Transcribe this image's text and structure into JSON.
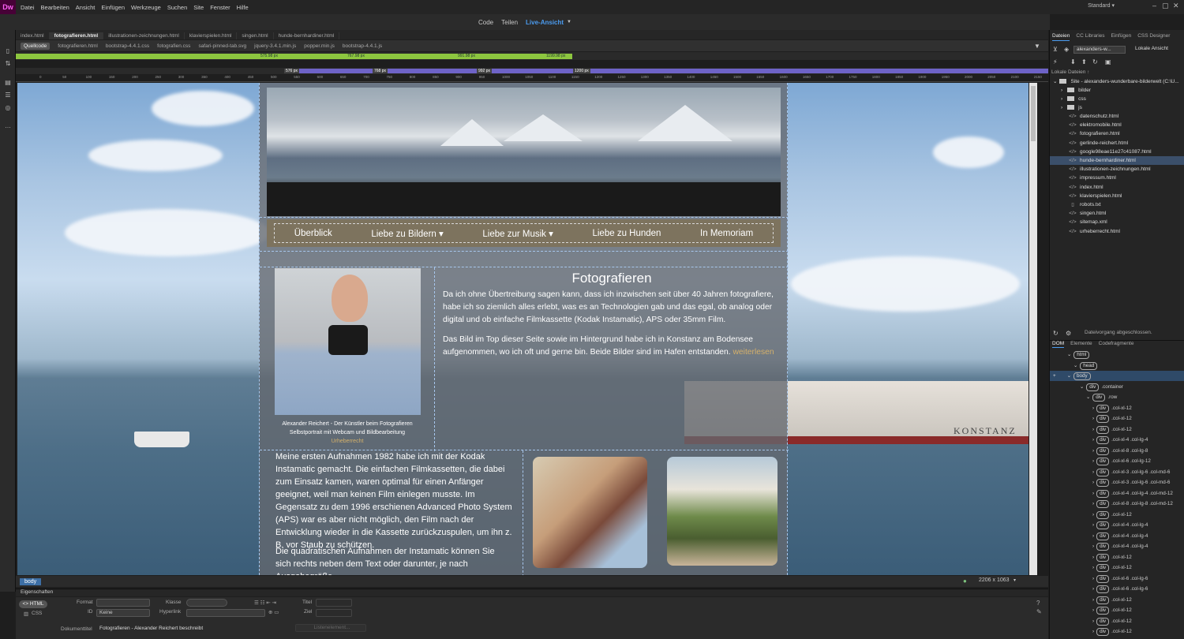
{
  "app": {
    "logo": "Dw",
    "menu": [
      "Datei",
      "Bearbeiten",
      "Ansicht",
      "Einfügen",
      "Werkzeuge",
      "Suchen",
      "Site",
      "Fenster",
      "Hilfe"
    ],
    "workspace": "Standard",
    "view_modes": [
      "Code",
      "Teilen",
      "Live-Ansicht"
    ]
  },
  "doc_tabs": [
    "index.html",
    "fotografieren.html",
    "illustrationen-zeichnungen.html",
    "klavierspielen.html",
    "singen.html",
    "hunde-bernhardiner.html"
  ],
  "active_tab": "fotografieren.html",
  "related_files": [
    "Quellcode",
    "fotografieren.html",
    "bootstrap-4.4.1.css",
    "fotografien.css",
    "safari-pinned-tab.svg",
    "jquery-3.4.1.min.js",
    "popper.min.js",
    "bootstrap-4.4.1.js"
  ],
  "media_queries": {
    "bar1": [
      "575.98 px",
      "767.98 px",
      "991.98 px",
      "1199.98 px"
    ],
    "bar2": [
      "576 px",
      "768 px",
      "992 px",
      "1200 px"
    ]
  },
  "ruler": [
    "0",
    "50",
    "100",
    "150",
    "200",
    "250",
    "300",
    "350",
    "400",
    "450",
    "500",
    "550",
    "600",
    "650",
    "700",
    "750",
    "800",
    "850",
    "900",
    "950",
    "1000",
    "1050",
    "1100",
    "1150",
    "1200",
    "1250",
    "1300",
    "1350",
    "1400",
    "1450",
    "1500",
    "1550",
    "1600",
    "1650",
    "1700",
    "1750",
    "1800",
    "1850",
    "1900",
    "1950",
    "2000",
    "2050",
    "2100",
    "2150"
  ],
  "page": {
    "nav": [
      "Überblick",
      "Liebe zu Bildern ▾",
      "Liebe zur Musik ▾",
      "Liebe zu Hunden",
      "In Memoriam"
    ],
    "caption_line1": "Alexander Reichert - Der Künstler beim Fotografieren",
    "caption_line2": "Selbstportrait mit Webcam und Bildbearbeitung",
    "caption_link": "Urheberrecht",
    "heading": "Fotografieren",
    "p1": "Da ich ohne Übertreibung sagen kann, dass ich inzwischen seit über 40 Jahren fotografiere, habe ich so ziemlich alles erlebt, was es an Technologien gab und das egal, ob analog oder digital und ob einfache Filmkassette (Kodak Instamatic), APS oder 35mm Film.",
    "p2": "Das Bild im Top dieser Seite sowie im Hintergrund habe ich in Konstanz am Bodensee aufgenommen, wo ich oft und gerne bin. Beide Bilder sind im Hafen entstanden.",
    "p2_link": "weiterlesen",
    "p3": "Meine ersten Aufnahmen 1982 habe ich mit der Kodak Instamatic gemacht. Die einfachen Filmkassetten, die dabei zum Einsatz kamen, waren optimal für einen Anfänger geeignet, weil man keinen Film einlegen musste. Im Gegensatz zu dem 1996 erschienen Advanced Photo System (APS) war es aber nicht möglich, den Film nach der Entwicklung wieder in die Kassette zurückzuspulen, um ihn z. B. vor Staub zu schützen.",
    "p4": "Die quadratischen Aufnahmen der Instamatic können Sie sich rechts neben dem Text oder darunter, je nach Ausgabegröße",
    "ship_name": "KONSTANZ"
  },
  "status": {
    "tag": "body",
    "dimensions": "2206 x 1063"
  },
  "properties": {
    "header": "Eigenschaften",
    "html_btn": "HTML",
    "css_btn": "CSS",
    "format_label": "Format",
    "id_label": "ID",
    "id_value": "Keine",
    "klasse_label": "Klasse",
    "hyperlink_label": "Hyperlink",
    "titel_label": "Titel",
    "ziel_label": "Ziel",
    "doctitle_label": "Dokumenttitel",
    "doctitle_value": "Fotografieren - Alexander Reichert beschreibt",
    "list_btn": "Listenelement..."
  },
  "files_panel": {
    "tabs": [
      "Dateien",
      "CC Libraries",
      "Einfügen",
      "CSS Designer"
    ],
    "site_select": "alexanders-w...",
    "view_select": "Lokale Ansicht",
    "local_header": "Lokale Dateien ↑",
    "site_root": "Site - alexanders-wunderbare-bilderwelt (C:\\U...",
    "folders": [
      "bilder",
      "css",
      "js"
    ],
    "files": [
      "datenschutz.html",
      "elektromobile.html",
      "fotografieren.html",
      "gerlinde-reichert.html",
      "google98eae11e27c41087.html",
      "hunde-bernhardiner.html",
      "illustrationen-zeichnungen.html",
      "impressum.html",
      "index.html",
      "klavierspielen.html",
      "robots.txt",
      "singen.html",
      "sitemap.xml",
      "urheberrecht.html"
    ],
    "selected_file": "hunde-bernhardiner.html",
    "status": "Dateivorgang abgeschlossen."
  },
  "dom_panel": {
    "tabs": [
      "DOM",
      "Elemente",
      "Codefragmente"
    ],
    "nodes": [
      {
        "tag": "html",
        "cls": ""
      },
      {
        "tag": "head",
        "cls": ""
      },
      {
        "tag": "body",
        "cls": ""
      },
      {
        "tag": "div",
        "cls": ".container"
      },
      {
        "tag": "div",
        "cls": ".row"
      },
      {
        "tag": "div",
        "cls": ".col-xl-12"
      },
      {
        "tag": "div",
        "cls": ".col-xl-12"
      },
      {
        "tag": "div",
        "cls": ".col-xl-12"
      },
      {
        "tag": "div",
        "cls": ".col-xl-4 .col-lg-4"
      },
      {
        "tag": "div",
        "cls": ".col-xl-8 .col-lg-8"
      },
      {
        "tag": "div",
        "cls": ".col-xl-6 .col-lg-12"
      },
      {
        "tag": "div",
        "cls": ".col-xl-3 .col-lg-6 .col-md-6"
      },
      {
        "tag": "div",
        "cls": ".col-xl-3 .col-lg-6 .col-md-6"
      },
      {
        "tag": "div",
        "cls": ".col-xl-4 .col-lg-4 .col-md-12"
      },
      {
        "tag": "div",
        "cls": ".col-xl-8 .col-lg-8 .col-md-12"
      },
      {
        "tag": "div",
        "cls": ".col-xl-12"
      },
      {
        "tag": "div",
        "cls": ".col-xl-4 .col-lg-4"
      },
      {
        "tag": "div",
        "cls": ".col-xl-4 .col-lg-4"
      },
      {
        "tag": "div",
        "cls": ".col-xl-4 .col-lg-4"
      },
      {
        "tag": "div",
        "cls": ".col-xl-12"
      },
      {
        "tag": "div",
        "cls": ".col-xl-12"
      },
      {
        "tag": "div",
        "cls": ".col-xl-6 .col-lg-6"
      },
      {
        "tag": "div",
        "cls": ".col-xl-6 .col-lg-6"
      },
      {
        "tag": "div",
        "cls": ".col-xl-12"
      },
      {
        "tag": "div",
        "cls": ".col-xl-12"
      },
      {
        "tag": "div",
        "cls": ".col-xl-12"
      },
      {
        "tag": "div",
        "cls": ".col-xl-12"
      }
    ]
  },
  "colors": {
    "accent": "#4b9cf0",
    "link_gold": "#d4b06a",
    "mq_green": "#8dc63f",
    "mq_purple": "#6e63c7"
  }
}
